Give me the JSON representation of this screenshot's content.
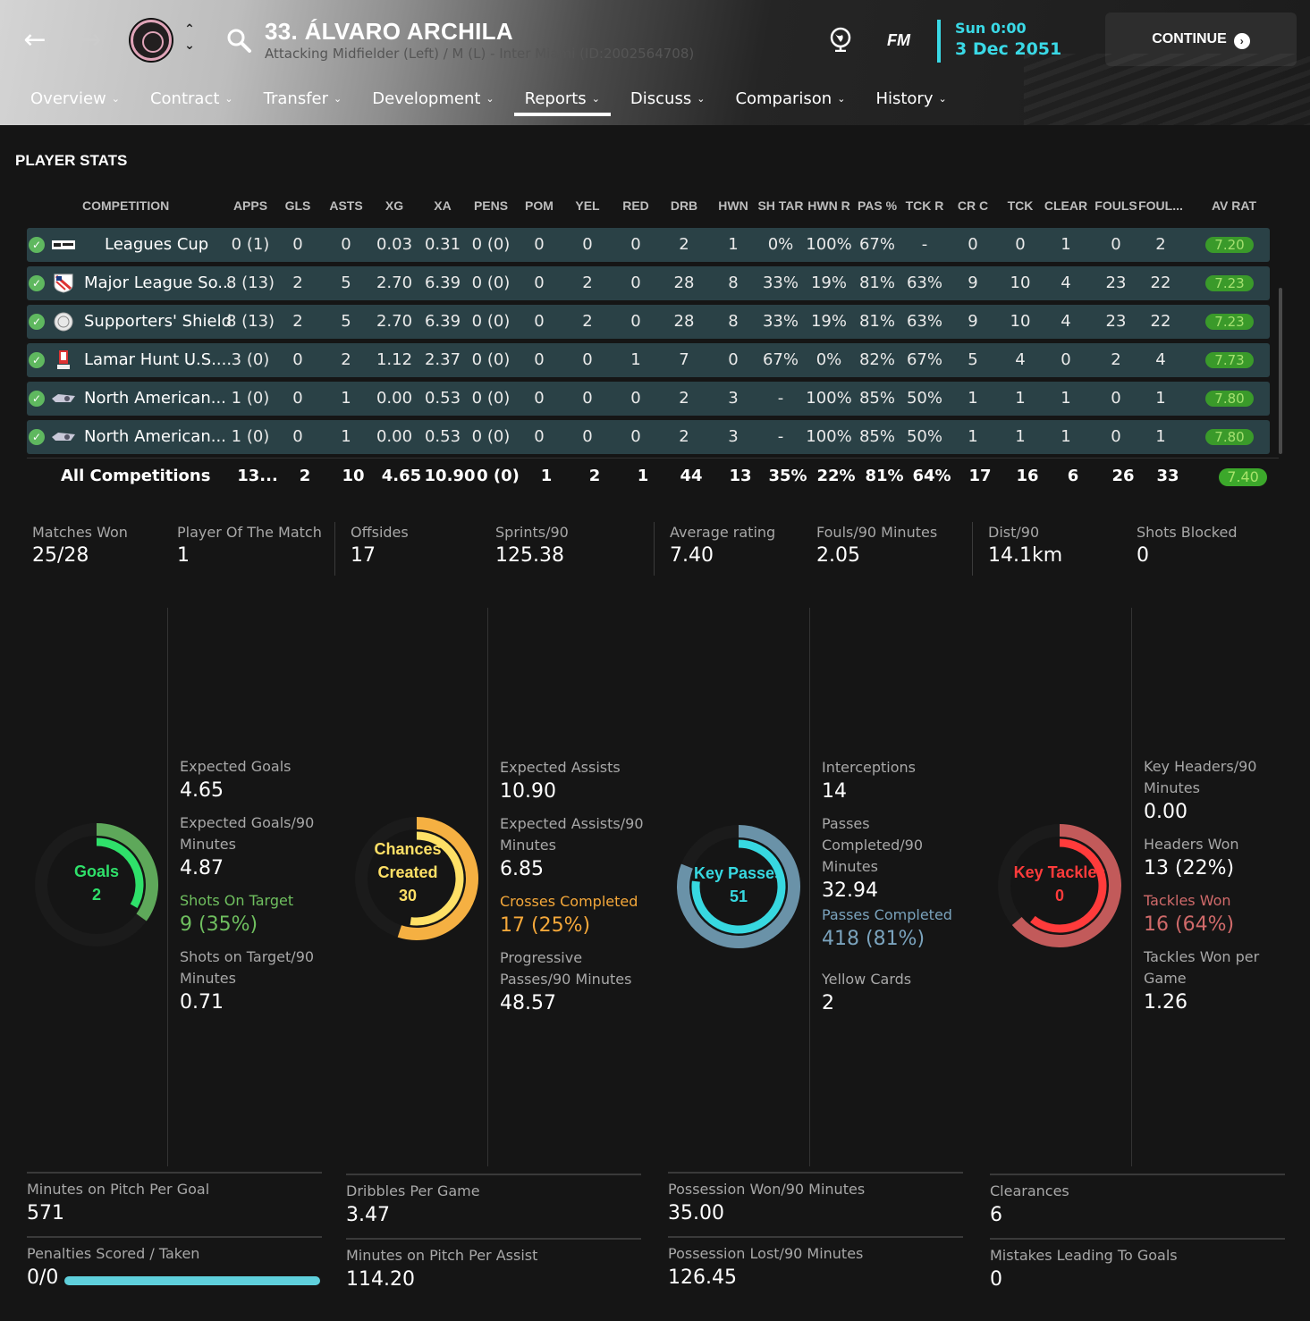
{
  "header": {
    "title": "33. ÁLVARO ARCHILA",
    "subtitle": "Attacking Midfielder (Left) / M (L) - Inter Miami (ID:2002564708)",
    "logo": "FM",
    "day": "Sun 0:00",
    "date": "3 Dec 2051",
    "continue": "CONTINUE",
    "accent": "#3ad9e6"
  },
  "tabs": [
    "Overview",
    "Contract",
    "Transfer",
    "Development",
    "Reports",
    "Discuss",
    "Comparison",
    "History"
  ],
  "active_tab": "Reports",
  "section_title": "PLAYER STATS",
  "columns": [
    "COMPETITION",
    "APPS",
    "GLS",
    "ASTS",
    "XG",
    "XA",
    "PENS",
    "POM",
    "YEL",
    "RED",
    "DRB",
    "HWN",
    "SH TAR",
    "HWN R",
    "PAS %",
    "TCK R",
    "CR C",
    "TCK",
    "CLEAR",
    "FOULS",
    "FOUL...",
    "AV RAT"
  ],
  "rows": [
    {
      "comp": "Leagues Cup",
      "icon": "leagues-cup-logo",
      "cells": [
        "0 (1)",
        "0",
        "0",
        "0.03",
        "0.31",
        "0 (0)",
        "0",
        "0",
        "0",
        "2",
        "1",
        "0%",
        "100%",
        "67%",
        "-",
        "0",
        "0",
        "1",
        "0",
        "2"
      ],
      "rating": "7.20"
    },
    {
      "comp": "Major League So...",
      "icon": "mls-logo",
      "cells": [
        "8 (13)",
        "2",
        "5",
        "2.70",
        "6.39",
        "0 (0)",
        "0",
        "2",
        "0",
        "28",
        "8",
        "33%",
        "19%",
        "81%",
        "63%",
        "9",
        "10",
        "4",
        "23",
        "22"
      ],
      "rating": "7.23"
    },
    {
      "comp": "Supporters' Shield",
      "icon": "supporters-shield-logo",
      "cells": [
        "8 (13)",
        "2",
        "5",
        "2.70",
        "6.39",
        "0 (0)",
        "0",
        "2",
        "0",
        "28",
        "8",
        "33%",
        "19%",
        "81%",
        "63%",
        "9",
        "10",
        "4",
        "23",
        "22"
      ],
      "rating": "7.23"
    },
    {
      "comp": "Lamar Hunt U.S....",
      "icon": "us-open-cup-logo",
      "cells": [
        "3 (0)",
        "0",
        "2",
        "1.12",
        "2.37",
        "0 (0)",
        "0",
        "0",
        "1",
        "7",
        "0",
        "67%",
        "0%",
        "82%",
        "67%",
        "5",
        "4",
        "0",
        "2",
        "4"
      ],
      "rating": "7.73"
    },
    {
      "comp": "North American...",
      "icon": "north-american-cup-logo",
      "cells": [
        "1 (0)",
        "0",
        "1",
        "0.00",
        "0.53",
        "0 (0)",
        "0",
        "0",
        "0",
        "2",
        "3",
        "-",
        "100%",
        "85%",
        "50%",
        "1",
        "1",
        "1",
        "0",
        "1"
      ],
      "rating": "7.80"
    },
    {
      "comp": "North American...",
      "icon": "north-american-cup-logo",
      "cells": [
        "1 (0)",
        "0",
        "1",
        "0.00",
        "0.53",
        "0 (0)",
        "0",
        "0",
        "0",
        "2",
        "3",
        "-",
        "100%",
        "85%",
        "50%",
        "1",
        "1",
        "1",
        "0",
        "1"
      ],
      "rating": "7.80"
    }
  ],
  "total": {
    "label": "All Competitions",
    "cells": [
      "13...",
      "2",
      "10",
      "4.65",
      "10.90",
      "0 (0)",
      "1",
      "2",
      "1",
      "44",
      "13",
      "35%",
      "22%",
      "81%",
      "64%",
      "17",
      "16",
      "6",
      "26",
      "33"
    ],
    "rating": "7.40"
  },
  "summary": [
    {
      "label": "Matches Won",
      "value": "25/28"
    },
    {
      "label": "Player Of The Match",
      "value": "1"
    },
    {
      "label": "Offsides",
      "value": "17"
    },
    {
      "label": "Sprints/90",
      "value": "125.38"
    },
    {
      "label": "Average rating",
      "value": "7.40"
    },
    {
      "label": "Fouls/90 Minutes",
      "value": "2.05"
    },
    {
      "label": "Dist/90",
      "value": "14.1km"
    },
    {
      "label": "Shots Blocked",
      "value": "0"
    }
  ],
  "rings": [
    {
      "title": "Goals",
      "value": "2",
      "color": "#2fe06a",
      "track": "#5ea85a",
      "fraction": 0.35
    },
    {
      "title": "Chances Created",
      "value": "30",
      "color": "#ffe066",
      "track": "#f5b042",
      "fraction": 0.55
    },
    {
      "title": "Key Passes",
      "value": "51",
      "color": "#37d8e0",
      "track": "#6a92a8",
      "fraction": 0.81
    },
    {
      "title": "Key Tackles",
      "value": "0",
      "color": "#ff3b3b",
      "track": "#c25a5a",
      "fraction": 0.64
    }
  ],
  "panels": [
    [
      {
        "label": "Expected Goals",
        "value": "4.65",
        "color": "#a8a8a8",
        "vcolor": "#ffffff"
      },
      {
        "label": "Expected Goals/90 Minutes",
        "value": "4.87",
        "color": "#a8a8a8",
        "vcolor": "#ffffff"
      },
      {
        "label": "Shots On Target",
        "value": "9 (35%)",
        "color": "#6fbf5f",
        "vcolor": "#6fbf5f"
      },
      {
        "label": "Shots on Target/90 Minutes",
        "value": "0.71",
        "color": "#a8a8a8",
        "vcolor": "#ffffff"
      }
    ],
    [
      {
        "label": "Expected Assists",
        "value": "10.90",
        "color": "#a8a8a8",
        "vcolor": "#ffffff"
      },
      {
        "label": "Expected Assists/90 Minutes",
        "value": "6.85",
        "color": "#a8a8a8",
        "vcolor": "#ffffff"
      },
      {
        "label": "Crosses Completed",
        "value": "17 (25%)",
        "color": "#f5a83a",
        "vcolor": "#f5a83a"
      },
      {
        "label": "Progressive Passes/90 Minutes",
        "value": "48.57",
        "color": "#a8a8a8",
        "vcolor": "#ffffff"
      }
    ],
    [
      {
        "label": "Interceptions",
        "value": "14",
        "color": "#a8a8a8",
        "vcolor": "#ffffff"
      },
      {
        "label": "Passes Completed/90 Minutes",
        "value": "32.94",
        "color": "#a8a8a8",
        "vcolor": "#ffffff"
      },
      {
        "label": "Passes Completed",
        "value": "418 (81%)",
        "color": "#7aa3bd",
        "vcolor": "#7aa3bd"
      },
      {
        "label": "Yellow Cards",
        "value": "2",
        "color": "#a8a8a8",
        "vcolor": "#ffffff"
      }
    ],
    [
      {
        "label": "Key Headers/90 Minutes",
        "value": "0.00",
        "color": "#a8a8a8",
        "vcolor": "#ffffff"
      },
      {
        "label": "Headers Won",
        "value": "13 (22%)",
        "color": "#a8a8a8",
        "vcolor": "#ffffff"
      },
      {
        "label": "Tackles Won",
        "value": "16 (64%)",
        "color": "#d06a6a",
        "vcolor": "#d06a6a"
      },
      {
        "label": "Tackles Won per Game",
        "value": "1.26",
        "color": "#a8a8a8",
        "vcolor": "#ffffff"
      }
    ]
  ],
  "bottom": [
    [
      {
        "label": "Minutes on Pitch Per Goal",
        "value": "571"
      },
      {
        "label": "Penalties Scored / Taken",
        "value": "0/0"
      }
    ],
    [
      {
        "label": "Dribbles Per Game",
        "value": "3.47"
      },
      {
        "label": "Minutes on Pitch Per Assist",
        "value": "114.20"
      }
    ],
    [
      {
        "label": "Possession Won/90 Minutes",
        "value": "35.00"
      },
      {
        "label": "Possession Lost/90 Minutes",
        "value": "126.45"
      }
    ],
    [
      {
        "label": "Clearances",
        "value": "6"
      },
      {
        "label": "Mistakes Leading To Goals",
        "value": "0"
      }
    ]
  ],
  "penalty_bar_fraction": 1.0
}
